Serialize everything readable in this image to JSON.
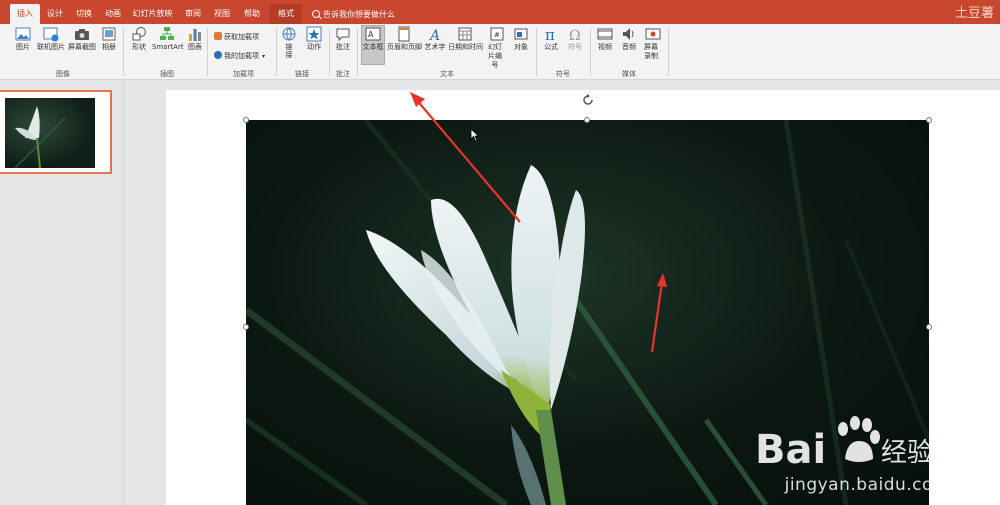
{
  "ribbon": {
    "tabs": [
      {
        "label": "插入",
        "active": true
      },
      {
        "label": "设计"
      },
      {
        "label": "切换"
      },
      {
        "label": "动画"
      },
      {
        "label": "幻灯片放映"
      },
      {
        "label": "审阅"
      },
      {
        "label": "视图"
      },
      {
        "label": "帮助"
      },
      {
        "label": "格式",
        "contextual": true
      }
    ],
    "tell_me": "告诉我你想要做什么",
    "user": "土豆薯",
    "groups": {
      "images": {
        "label": "图像",
        "buttons": [
          "图片",
          "联机图片",
          "屏幕截图",
          "相册"
        ]
      },
      "illustrations": {
        "label": "插图",
        "buttons": [
          "形状",
          "SmartArt",
          "图表"
        ]
      },
      "addins": {
        "label": "加载项",
        "buttons": [
          "获取加载项",
          "我的加载项"
        ]
      },
      "links": {
        "label": "链接",
        "buttons": [
          "链接",
          "动作"
        ]
      },
      "comments": {
        "label": "批注",
        "buttons": [
          "批注"
        ]
      },
      "text": {
        "label": "文本",
        "buttons": [
          "文本框",
          "页眉和页脚",
          "艺术字",
          "日期和时间",
          "幻灯片编号",
          "对象"
        ]
      },
      "symbols": {
        "label": "符号",
        "buttons": [
          "公式",
          "符号"
        ]
      },
      "media": {
        "label": "媒体",
        "buttons": [
          "视频",
          "音频",
          "屏幕录制"
        ]
      }
    },
    "accent_color": "#c8472e"
  },
  "watermark": {
    "brand": "Bai",
    "brand_suffix": "经验",
    "url": "jingyan.baidu.com"
  }
}
